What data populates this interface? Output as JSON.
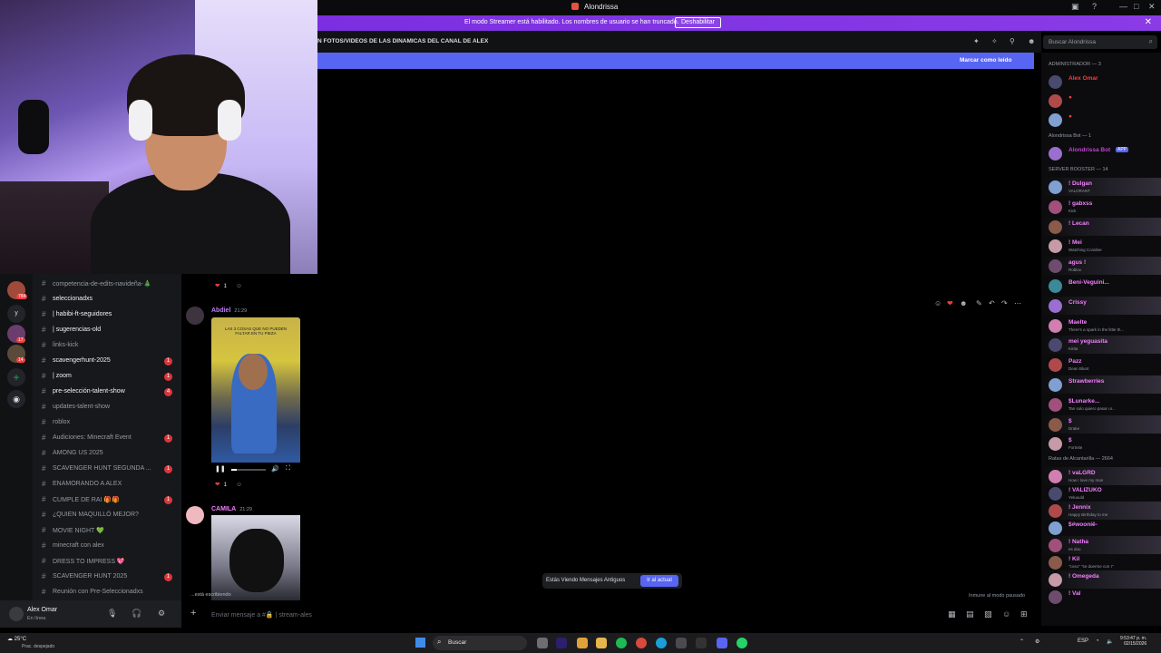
{
  "window": {
    "title": "Alondrissa"
  },
  "banner": {
    "message": "El modo Streamer está habilitado. Los nombres de usuario se han truncado.",
    "button": "Deshabilitar"
  },
  "channel_header": {
    "topic": "N FOTOS/VIDEOS DE LAS DINAMICAS DEL CANAL DE ALEX",
    "search_placeholder": "Buscar Alondrissa"
  },
  "unread_bar": {
    "label": "Marcar como leído"
  },
  "server_rail": {
    "badges": [
      "784",
      "y",
      "17",
      "14"
    ]
  },
  "channels": [
    {
      "label": "competencia-de-edits-navideña-🎄",
      "bright": false,
      "badge": ""
    },
    {
      "label": "seleccionadxs",
      "bright": true,
      "badge": ""
    },
    {
      "label": "| habibi-ft-seguidores",
      "bright": true,
      "badge": ""
    },
    {
      "label": "| sugerencias-old",
      "bright": true,
      "badge": ""
    },
    {
      "label": "links-kick",
      "bright": false,
      "badge": ""
    },
    {
      "label": "scavengerhunt-2025",
      "bright": true,
      "badge": "1"
    },
    {
      "label": "| zoom",
      "bright": true,
      "badge": "1"
    },
    {
      "label": "pre-selección-talent-show",
      "bright": true,
      "badge": "4"
    },
    {
      "label": "updates-talent-show",
      "bright": false,
      "badge": ""
    },
    {
      "label": "roblox",
      "bright": false,
      "badge": ""
    },
    {
      "label": "Audiciones: Minecraft Event",
      "bright": false,
      "badge": "1"
    },
    {
      "label": "AMONG US 2025",
      "bright": false,
      "badge": ""
    },
    {
      "label": "SCAVENGER HUNT SEGUNDA ...",
      "bright": false,
      "badge": "1"
    },
    {
      "label": "ENAMORANDO A ALEX",
      "bright": false,
      "badge": ""
    },
    {
      "label": "CUMPLE DE RAI 🎁🎁",
      "bright": false,
      "badge": "1"
    },
    {
      "label": "¿QUIEN MAQUILLÓ MEJOR?",
      "bright": false,
      "badge": ""
    },
    {
      "label": "MOVIE NIGHT 💚",
      "bright": false,
      "badge": ""
    },
    {
      "label": "minecraft con alex",
      "bright": false,
      "badge": ""
    },
    {
      "label": "DRESS TO IMPRESS 💖",
      "bright": false,
      "badge": ""
    },
    {
      "label": "SCAVENGER HUNT 2025",
      "bright": false,
      "badge": "1"
    },
    {
      "label": "Reunión con Pre-Seleccionadxs",
      "bright": false,
      "badge": ""
    }
  ],
  "user": {
    "name": "Alex Omar",
    "status": "En línea"
  },
  "messages": [
    {
      "author": "Abdiel",
      "time": "21:29",
      "color": "#c27cf6",
      "reaction_count": "1"
    },
    {
      "author": "CAMILA",
      "time": "21:29",
      "color": "#f47fff",
      "reaction_count": "1"
    }
  ],
  "video": {
    "caption": "LAS 3 COSAS QUE NO PUEDEN FALTAR EN TU PIEZA"
  },
  "old_messages": {
    "text": "Estás Viendo Mensajes Antiguos",
    "button": "Ir al actual"
  },
  "typing": "...está escribiendo",
  "inactive_notice": "Inmune al modo pausado",
  "composer": {
    "placeholder": "Enviar mensaje a #🔒 | stream-ales"
  },
  "members": {
    "groups": [
      "ADMINISTRADOR — 3",
      "Alondrissa Bot — 1",
      "SERVER BOOSTER — 14",
      "Ratas de Alcantarilla — 2664"
    ],
    "admins": [
      {
        "name": "Alex Omar",
        "color": "#f23f43",
        "sub": ""
      },
      {
        "name": "●",
        "color": "#f23f43",
        "sub": ""
      },
      {
        "name": "●",
        "color": "#f23f43",
        "sub": ""
      }
    ],
    "bots": [
      {
        "name": "Alondrissa Bot",
        "color": "#c73fd8",
        "sub": "",
        "tag": "APP"
      }
    ],
    "boosters": [
      {
        "name": "! Dulgan",
        "color": "#f47fff",
        "sub": "VALORANT"
      },
      {
        "name": "! gabxss",
        "color": "#f47fff",
        "sub": "Kick"
      },
      {
        "name": "! Lecan",
        "color": "#f47fff",
        "sub": ""
      },
      {
        "name": "! Mei",
        "color": "#f47fff",
        "sub": "Watching Coraline"
      },
      {
        "name": "agus !",
        "color": "#f47fff",
        "sub": "Roblox"
      },
      {
        "name": "Beni-Veguini...",
        "color": "#f47fff",
        "sub": ""
      },
      {
        "name": "Crissy",
        "color": "#f47fff",
        "sub": ""
      },
      {
        "name": "Maelte",
        "color": "#f47fff",
        "sub": "There's a spark in the little th..."
      },
      {
        "name": "mei yeguasita",
        "color": "#f47fff",
        "sub": "Kirita"
      },
      {
        "name": "Pazz",
        "color": "#f47fff",
        "sub": "Dean Blunt"
      },
      {
        "name": "Strawberries",
        "color": "#f47fff",
        "sub": ""
      },
      {
        "name": "$Lunarke...",
        "color": "#f47fff",
        "sub": "Tan solo quiero pasar ur..."
      },
      {
        "name": "$",
        "color": "#f47fff",
        "sub": "Drake"
      },
      {
        "name": "$",
        "color": "#f47fff",
        "sub": "Fortnite"
      }
    ],
    "ratas": [
      {
        "name": "! vaLGRD",
        "color": "#f47fff",
        "sub": "How I love my man"
      },
      {
        "name": "! VALIZUKO",
        "color": "#f47fff",
        "sub": "Yeluuuld"
      },
      {
        "name": "! Jennix",
        "color": "#f47fff",
        "sub": "Happy Birthday to me"
      },
      {
        "name": "$#woonië-",
        "color": "#f47fff",
        "sub": ""
      },
      {
        "name": "! Natha",
        "color": "#f47fff",
        "sub": "es dou"
      },
      {
        "name": "! Kil",
        "color": "#f47fff",
        "sub": "\"coso\" \"se duerme con I\""
      },
      {
        "name": "! Omegeda",
        "color": "#f47fff",
        "sub": ""
      },
      {
        "name": "! Val",
        "color": "#f47fff",
        "sub": ""
      }
    ]
  },
  "taskbar": {
    "weather": "25°C",
    "weather_sub": "Prac. despejado",
    "search": "Buscar",
    "lang": "ESP",
    "time": "9:53:47 p. m.",
    "date": "02/15/2026"
  }
}
